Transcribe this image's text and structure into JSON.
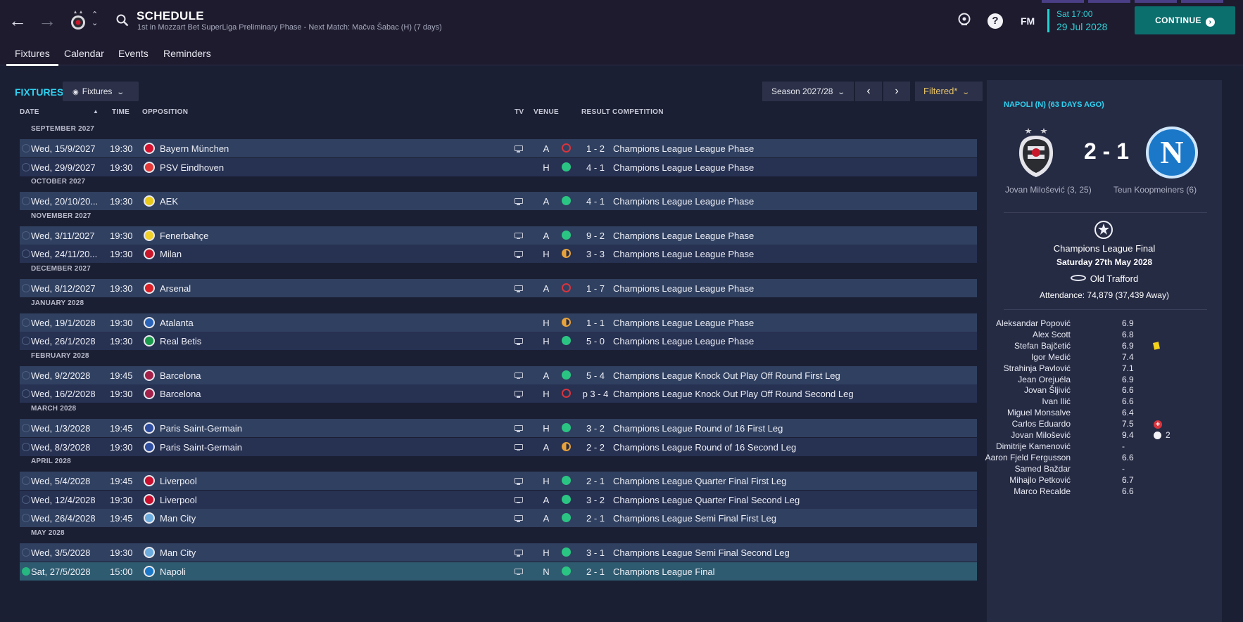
{
  "header": {
    "title": "SCHEDULE",
    "subtitle": "1st in Mozzart Bet SuperLiga Preliminary Phase - Next Match: Mačva Šabac (H) (7 days)",
    "time": "Sat 17:00",
    "date": "29 Jul 2028",
    "continue_label": "CONTINUE",
    "fm_label": "FM",
    "help_label": "?"
  },
  "tabs": [
    "Fixtures",
    "Calendar",
    "Events",
    "Reminders"
  ],
  "toolbar": {
    "heading": "FIXTURES",
    "view_dropdown": "Fixtures",
    "season": "Season 2027/28",
    "filter": "Filtered*"
  },
  "columns": {
    "date": "DATE",
    "time": "TIME",
    "opposition": "OPPOSITION",
    "tv": "TV",
    "venue": "VENUE",
    "result": "RESULT",
    "competition": "COMPETITION"
  },
  "months": [
    {
      "label": "SEPTEMBER 2027",
      "fixtures": [
        {
          "date": "Wed, 15/9/2027",
          "time": "19:30",
          "opp": "Bayern München",
          "tv": true,
          "venue": "A",
          "res": "L",
          "score": "1 - 2",
          "comp": "Champions League League Phase",
          "crest": "#d3132f"
        },
        {
          "date": "Wed, 29/9/2027",
          "time": "19:30",
          "opp": "PSV Eindhoven",
          "tv": false,
          "venue": "H",
          "res": "W",
          "score": "4 - 1",
          "comp": "Champions League League Phase",
          "crest": "#e43a3a"
        }
      ]
    },
    {
      "label": "OCTOBER 2027",
      "fixtures": [
        {
          "date": "Wed, 20/10/20...",
          "time": "19:30",
          "opp": "AEK",
          "tv": true,
          "venue": "A",
          "res": "W",
          "score": "4 - 1",
          "comp": "Champions League League Phase",
          "crest": "#e8c81a"
        }
      ]
    },
    {
      "label": "NOVEMBER 2027",
      "fixtures": [
        {
          "date": "Wed, 3/11/2027",
          "time": "19:30",
          "opp": "Fenerbahçe",
          "tv": true,
          "venue": "A",
          "res": "W",
          "score": "9 - 2",
          "comp": "Champions League League Phase",
          "crest": "#f0d12b"
        },
        {
          "date": "Wed, 24/11/20...",
          "time": "19:30",
          "opp": "Milan",
          "tv": true,
          "venue": "H",
          "res": "D",
          "score": "3 - 3",
          "comp": "Champions League League Phase",
          "crest": "#c8172a"
        }
      ]
    },
    {
      "label": "DECEMBER 2027",
      "fixtures": [
        {
          "date": "Wed, 8/12/2027",
          "time": "19:30",
          "opp": "Arsenal",
          "tv": true,
          "venue": "A",
          "res": "L",
          "score": "1 - 7",
          "comp": "Champions League League Phase",
          "crest": "#db1f26"
        }
      ]
    },
    {
      "label": "JANUARY 2028",
      "fixtures": [
        {
          "date": "Wed, 19/1/2028",
          "time": "19:30",
          "opp": "Atalanta",
          "tv": false,
          "venue": "H",
          "res": "D",
          "score": "1 - 1",
          "comp": "Champions League League Phase",
          "crest": "#2a64b8"
        },
        {
          "date": "Wed, 26/1/2028",
          "time": "19:30",
          "opp": "Real Betis",
          "tv": true,
          "venue": "H",
          "res": "W",
          "score": "5 - 0",
          "comp": "Champions League League Phase",
          "crest": "#1b9a4b"
        }
      ]
    },
    {
      "label": "FEBRUARY 2028",
      "fixtures": [
        {
          "date": "Wed, 9/2/2028",
          "time": "19:45",
          "opp": "Barcelona",
          "tv": true,
          "venue": "A",
          "res": "W",
          "score": "5 - 4",
          "comp": "Champions League Knock Out Play Off Round First Leg",
          "crest": "#a3224a"
        },
        {
          "date": "Wed, 16/2/2028",
          "time": "19:30",
          "opp": "Barcelona",
          "tv": true,
          "venue": "H",
          "res": "L",
          "score": "p 3 - 4",
          "comp": "Champions League Knock Out Play Off Round Second Leg",
          "crest": "#a3224a"
        }
      ]
    },
    {
      "label": "MARCH 2028",
      "fixtures": [
        {
          "date": "Wed, 1/3/2028",
          "time": "19:45",
          "opp": "Paris Saint-Germain",
          "tv": true,
          "venue": "H",
          "res": "W",
          "score": "3 - 2",
          "comp": "Champions League Round of 16  First Leg",
          "crest": "#2f4ea0"
        },
        {
          "date": "Wed, 8/3/2028",
          "time": "19:30",
          "opp": "Paris Saint-Germain",
          "tv": true,
          "venue": "A",
          "res": "D",
          "score": "2 - 2",
          "comp": "Champions League Round of 16  Second Leg",
          "crest": "#2f4ea0"
        }
      ]
    },
    {
      "label": "APRIL 2028",
      "fixtures": [
        {
          "date": "Wed, 5/4/2028",
          "time": "19:45",
          "opp": "Liverpool",
          "tv": true,
          "venue": "H",
          "res": "W",
          "score": "2 - 1",
          "comp": "Champions League Quarter Final First Leg",
          "crest": "#c8102e"
        },
        {
          "date": "Wed, 12/4/2028",
          "time": "19:30",
          "opp": "Liverpool",
          "tv": true,
          "venue": "A",
          "res": "W",
          "score": "3 - 2",
          "comp": "Champions League Quarter Final Second Leg",
          "crest": "#c8102e"
        },
        {
          "date": "Wed, 26/4/2028",
          "time": "19:45",
          "opp": "Man City",
          "tv": true,
          "venue": "A",
          "res": "W",
          "score": "2 - 1",
          "comp": "Champions League Semi Final First Leg",
          "crest": "#6cabdd"
        }
      ]
    },
    {
      "label": "MAY 2028",
      "fixtures": [
        {
          "date": "Wed, 3/5/2028",
          "time": "19:30",
          "opp": "Man City",
          "tv": true,
          "venue": "H",
          "res": "W",
          "score": "3 - 1",
          "comp": "Champions League Semi Final Second Leg",
          "crest": "#6cabdd"
        },
        {
          "date": "Sat, 27/5/2028",
          "time": "15:00",
          "opp": "Napoli",
          "tv": true,
          "venue": "N",
          "res": "W",
          "score": "2 - 1",
          "comp": "Champions League Final",
          "crest": "#1b78c9",
          "selected": true
        }
      ]
    }
  ],
  "match": {
    "heading": "NAPOLI (N) (63 DAYS AGO)",
    "score": "2 - 1",
    "home_scorers": "Jovan Milošević (3, 25)",
    "away_scorers": "Teun Koopmeiners (6)",
    "away_crest_letter": "N",
    "competition": "Champions League Final",
    "date": "Saturday 27th May 2028",
    "stadium": "Old Trafford",
    "attendance": "Attendance: 74,879 (37,439 Away)",
    "players": [
      {
        "name": "Aleksandar Popović",
        "rating": "6.9"
      },
      {
        "name": "Alex Scott",
        "rating": "6.8"
      },
      {
        "name": "Stefan Bajčetić",
        "rating": "6.9",
        "icon": "yellow-card"
      },
      {
        "name": "Igor Medić",
        "rating": "7.4"
      },
      {
        "name": "Strahinja Pavlović",
        "rating": "7.1"
      },
      {
        "name": "Jean Orejuéla",
        "rating": "6.9"
      },
      {
        "name": "Jovan Šljivić",
        "rating": "6.6"
      },
      {
        "name": "Ivan Ilić",
        "rating": "6.6"
      },
      {
        "name": "Miguel Monsalve",
        "rating": "6.4"
      },
      {
        "name": "Carlos Eduardo",
        "rating": "7.5",
        "icon": "injury"
      },
      {
        "name": "Jovan Milošević",
        "rating": "9.4",
        "icon": "goal",
        "goals": "2"
      },
      {
        "name": "Dimitrije Kamenović",
        "rating": "-"
      },
      {
        "name": "Aaron Fjeld Fergusson",
        "rating": "6.6"
      },
      {
        "name": "Samed Baždar",
        "rating": "-"
      },
      {
        "name": "Mihajlo Petković",
        "rating": "6.7"
      },
      {
        "name": "Marco Recalde",
        "rating": "6.6"
      }
    ]
  },
  "colors": {
    "accent": "#2ed2f1",
    "win": "#2bc583",
    "loss": "#d9343d",
    "draw": "#e6a23c",
    "continue": "#0b6f6e"
  }
}
